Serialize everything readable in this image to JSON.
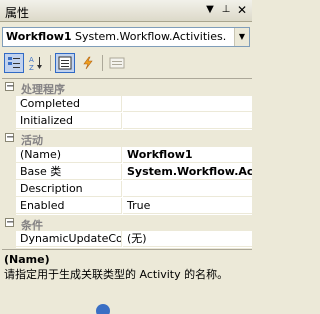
{
  "window": {
    "title": "属性",
    "pin_icon": "pin-icon",
    "dropdown_icon": "menu-down-icon",
    "close_icon": "close-icon"
  },
  "object_selector": {
    "name": "Workflow1",
    "type": "System.Workflow.Activities.",
    "dropdown_icon": "chevron-down-icon"
  },
  "toolbar": {
    "categorized_icon": "categorized-icon",
    "alphabetical_icon": "sort-az-icon",
    "properties_icon": "properties-icon",
    "events_icon": "lightning-icon",
    "property_pages_icon": "property-pages-icon"
  },
  "categories": [
    {
      "label": "处理程序",
      "rows": [
        {
          "name": "Completed",
          "value": "",
          "has_handler_icon": true
        },
        {
          "name": "Initialized",
          "value": "",
          "has_handler_icon": true
        }
      ]
    },
    {
      "label": "活动",
      "rows": [
        {
          "name": "(Name)",
          "value": "Workflow1",
          "bold": true
        },
        {
          "name": "Base 类",
          "value": "System.Workflow.Ac",
          "bold": true
        },
        {
          "name": "Description",
          "value": ""
        },
        {
          "name": "Enabled",
          "value": "True"
        }
      ]
    },
    {
      "label": "条件",
      "rows": [
        {
          "name": "DynamicUpdateCond",
          "value": "(无)"
        }
      ]
    }
  ],
  "description": {
    "title": "(Name)",
    "text": "请指定用于生成关联类型的 Activity 的名称。"
  },
  "colors": {
    "toolbar_active": "#c1d2ee",
    "category_text": "#848284",
    "panel_bg": "#ece9d8",
    "handler_icon": "#e8b830"
  }
}
